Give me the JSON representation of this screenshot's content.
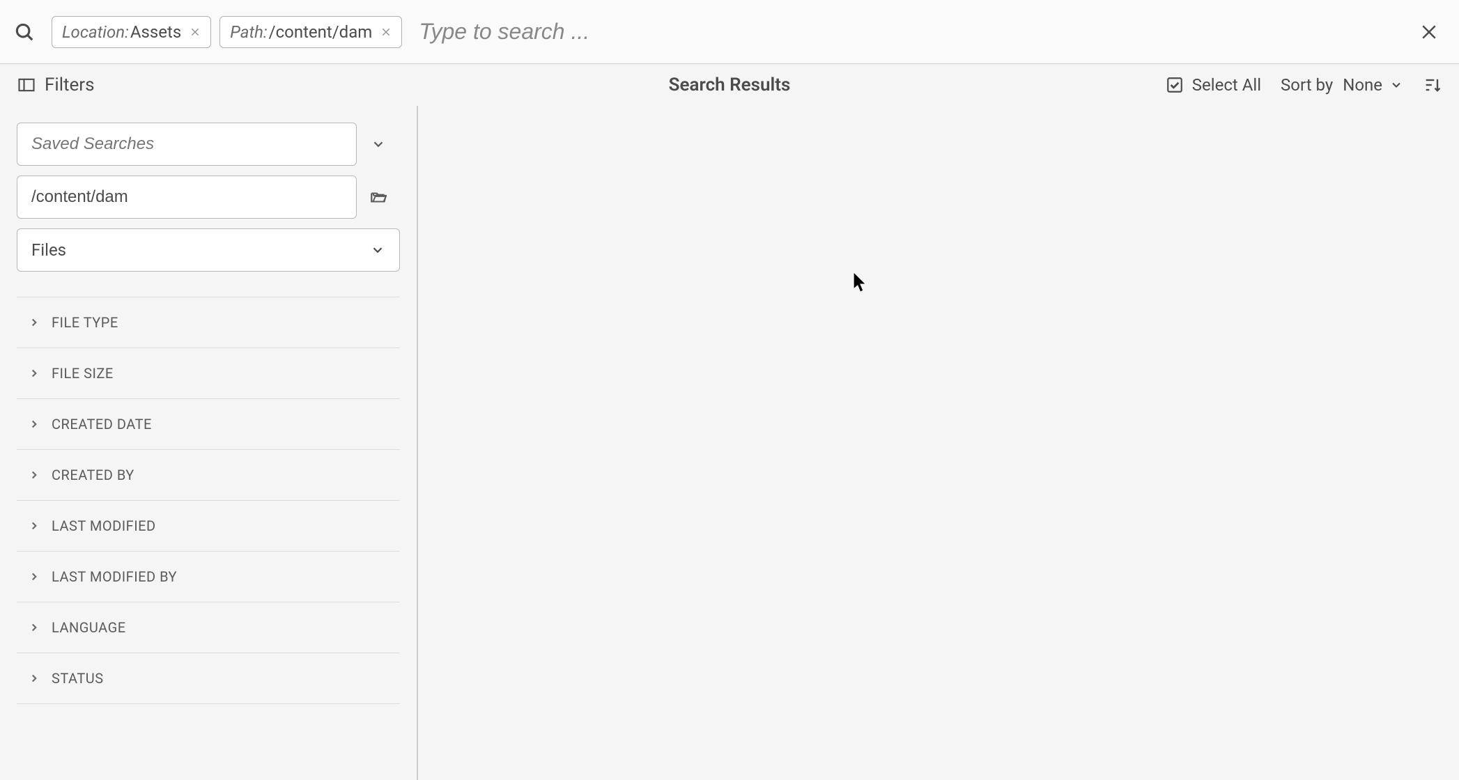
{
  "search": {
    "placeholder": "Type to search ...",
    "tags": [
      {
        "label": "Location:",
        "value": " Assets"
      },
      {
        "label": "Path:",
        "value": "/content/dam"
      }
    ]
  },
  "toolbar": {
    "filters_label": "Filters",
    "results_title": "Search Results",
    "select_all_label": "Select All",
    "sort_by_label": "Sort by",
    "sort_value": "None"
  },
  "filter_panel": {
    "saved_searches_placeholder": "Saved Searches",
    "path_value": "/content/dam",
    "type_value": "Files",
    "sections": [
      "FILE TYPE",
      "FILE SIZE",
      "CREATED DATE",
      "CREATED BY",
      "LAST MODIFIED",
      "LAST MODIFIED BY",
      "LANGUAGE",
      "STATUS"
    ]
  }
}
